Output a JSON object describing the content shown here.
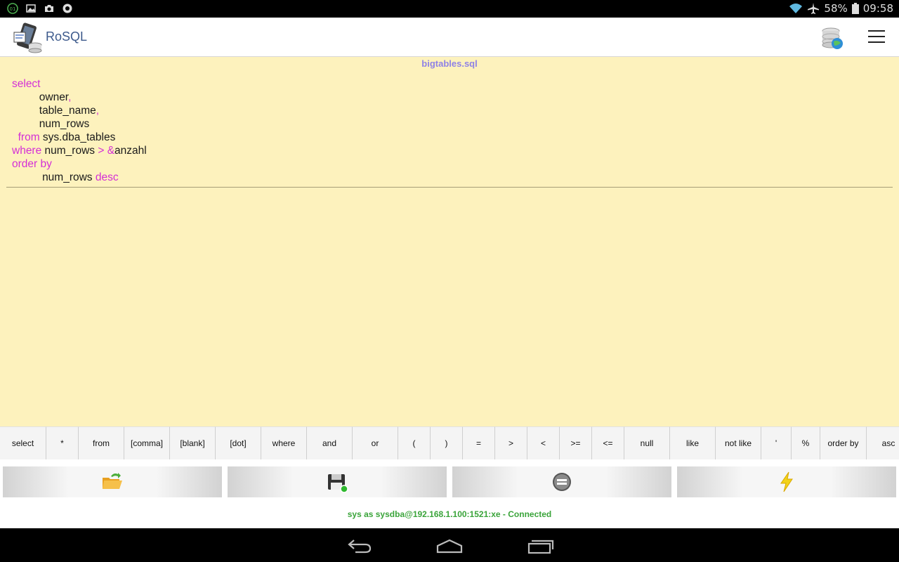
{
  "status_bar": {
    "battery": "58%",
    "time": "09:58"
  },
  "app": {
    "title": "RoSQL"
  },
  "editor": {
    "file_name": "bigtables.sql",
    "lines": [
      [
        {
          "t": "select",
          "k": true
        }
      ],
      [
        {
          "t": "         owner",
          "k": false
        },
        {
          "t": ",",
          "k": true
        }
      ],
      [
        {
          "t": "         table_name",
          "k": false
        },
        {
          "t": ",",
          "k": true
        }
      ],
      [
        {
          "t": "         num_rows",
          "k": false
        }
      ],
      [
        {
          "t": "  from",
          "k": true
        },
        {
          "t": " sys.dba_tables",
          "k": false
        }
      ],
      [
        {
          "t": "where",
          "k": true
        },
        {
          "t": " num_rows ",
          "k": false
        },
        {
          "t": "> &",
          "k": true
        },
        {
          "t": "anzahl",
          "k": false
        }
      ],
      [
        {
          "t": "order by",
          "k": true
        }
      ],
      [
        {
          "t": "          num_rows ",
          "k": false
        },
        {
          "t": "desc",
          "k": true
        }
      ]
    ]
  },
  "keyword_bar": {
    "keywords": [
      "select",
      "*",
      "from",
      "[comma]",
      "[blank]",
      "[dot]",
      "where",
      "and",
      "or",
      "(",
      ")",
      "=",
      ">",
      "<",
      ">=",
      "<=",
      "null",
      "like",
      "not like",
      "'",
      "%",
      "order by",
      "asc"
    ]
  },
  "toolbar": {
    "buttons": [
      {
        "name": "open-file-button",
        "icon": "folder-open-icon"
      },
      {
        "name": "save-file-button",
        "icon": "floppy-disk-icon"
      },
      {
        "name": "clear-button",
        "icon": "equals-circle-icon"
      },
      {
        "name": "execute-button",
        "icon": "lightning-icon"
      }
    ]
  },
  "connection": {
    "status_text": "sys as sysdba@192.168.1.100:1521:xe - Connected"
  },
  "colors": {
    "editor_bg": "#fdf2bd",
    "keyword": "#d42fd6",
    "file_name": "#8f82e6",
    "connected": "#3aa43a",
    "app_title": "#3d5a8c"
  }
}
